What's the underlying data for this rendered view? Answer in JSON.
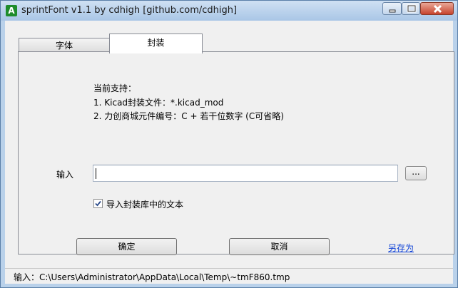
{
  "window": {
    "title": "sprintFont v1.1 by cdhigh [github.com/cdhigh]",
    "icon_letter": "A"
  },
  "tabs": [
    {
      "label": "字体",
      "selected": false
    },
    {
      "label": "封装",
      "selected": true
    }
  ],
  "info": {
    "line1": "当前支持：",
    "line2": "1. Kicad封装文件：*.kicad_mod",
    "line3": "2. 力创商城元件编号：C + 若干位数字 (C可省略)"
  },
  "input": {
    "label": "输入",
    "value": "",
    "browse_label": "..."
  },
  "checkbox": {
    "label": "导入封装库中的文本",
    "checked": true
  },
  "buttons": {
    "ok": "确定",
    "cancel": "取消",
    "save_as": "另存为"
  },
  "status": {
    "text": "输入：C:\\Users\\Administrator\\AppData\\Local\\Temp\\~tmF860.tmp"
  }
}
